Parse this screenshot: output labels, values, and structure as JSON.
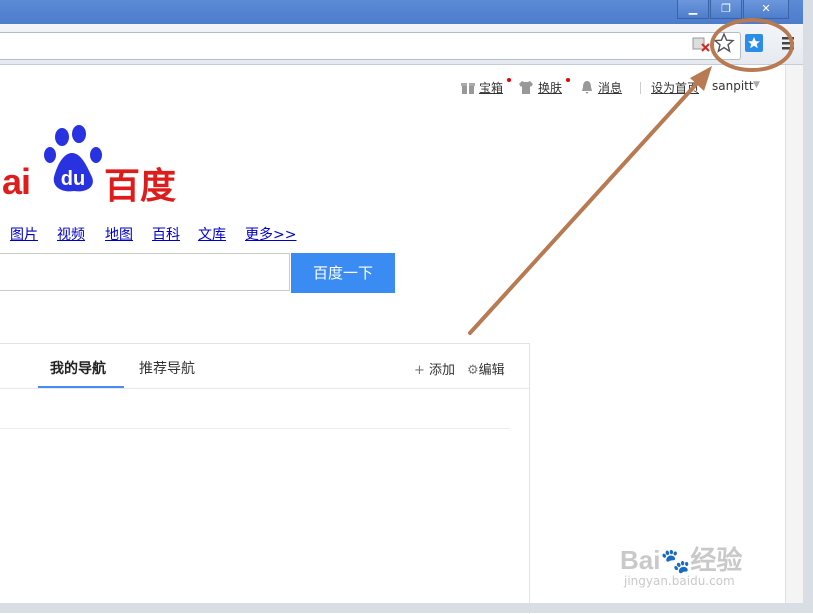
{
  "window": {
    "minimize_icon": "minimize-icon",
    "restore_icon": "restore-icon",
    "close_icon": "close-icon"
  },
  "toolbar": {
    "icons": [
      "puzzle-error-icon",
      "star-icon",
      "bookmark-extension-icon",
      "menu-icon"
    ]
  },
  "header": {
    "links": [
      {
        "label": "宝箱",
        "icon": "gift-icon",
        "badge": true
      },
      {
        "label": "换肤",
        "icon": "shirt-icon",
        "badge": true
      },
      {
        "label": "消息",
        "icon": "bell-icon",
        "badge": false
      },
      {
        "label": "设为首页",
        "icon": "",
        "badge": false
      },
      {
        "label": "sanpitt",
        "icon": "caret-down-icon",
        "badge": false
      }
    ]
  },
  "logo": {
    "latin": "ai",
    "du": "du",
    "chinese": "百度"
  },
  "nav": {
    "links": [
      "图片",
      "视频",
      "地图",
      "百科",
      "文库",
      "更多>>"
    ]
  },
  "search": {
    "value": "",
    "button_label": "百度一下"
  },
  "panel": {
    "tab_active": "我的导航",
    "tab_other": "推荐导航",
    "add_label": "添加",
    "edit_label": "编辑"
  },
  "watermark": {
    "brand": "Bai",
    "brand_cn": "经验",
    "url": "jingyan.baidu.com"
  },
  "colors": {
    "accent": "#3b8cf2",
    "brand_red": "#de1c1c",
    "brand_blue": "#2932e1",
    "annotation": "#b87a52"
  }
}
